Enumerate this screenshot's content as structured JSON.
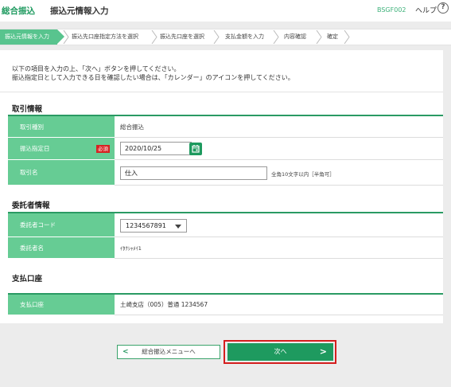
{
  "header": {
    "app_name": "総合振込",
    "screen_title": "振込元情報入力",
    "screen_id": "BSGF002",
    "help_label": "ヘルプ",
    "help_icon": "help-question-icon"
  },
  "steps": [
    {
      "label": "振込元情報を入力",
      "active": true
    },
    {
      "label": "振込先口座指定方法を選択",
      "active": false
    },
    {
      "label": "振込先口座を選択",
      "active": false
    },
    {
      "label": "支払金額を入力",
      "active": false
    },
    {
      "label": "内容確認",
      "active": false
    },
    {
      "label": "確定",
      "active": false
    }
  ],
  "intro": {
    "line1": "以下の項目を入力の上、「次へ」ボタンを押してください。",
    "line2": "振込指定日として入力できる日を確認したい場合は、「カレンダー」のアイコンを押してください。"
  },
  "transaction": {
    "title": "取引情報",
    "type_label": "取引種別",
    "type_value": "総合振込",
    "date_label": "振込指定日",
    "required_badge": "必須",
    "date_value": "2020/10/25",
    "calendar_icon": "calendar-icon",
    "name_label": "取引名",
    "name_value": "仕入",
    "name_note": "全角10文字以内［半角可］"
  },
  "consignor": {
    "title": "委託者情報",
    "code_label": "委託者コード",
    "code_value": "1234567891",
    "name_label": "委託者名",
    "name_value": "ｲﾀｸｼｬﾒｲ1"
  },
  "payment": {
    "title": "支払口座",
    "account_label": "支払口座",
    "account_value": "土崎支店（005）普通 1234567"
  },
  "footer": {
    "back_label": "総合振込メニューへ",
    "next_label": "次へ"
  },
  "colors": {
    "brand_green": "#1e9a5f",
    "label_green": "#66cc94",
    "required_red": "#d62222",
    "highlight_red": "#d41e1e"
  }
}
